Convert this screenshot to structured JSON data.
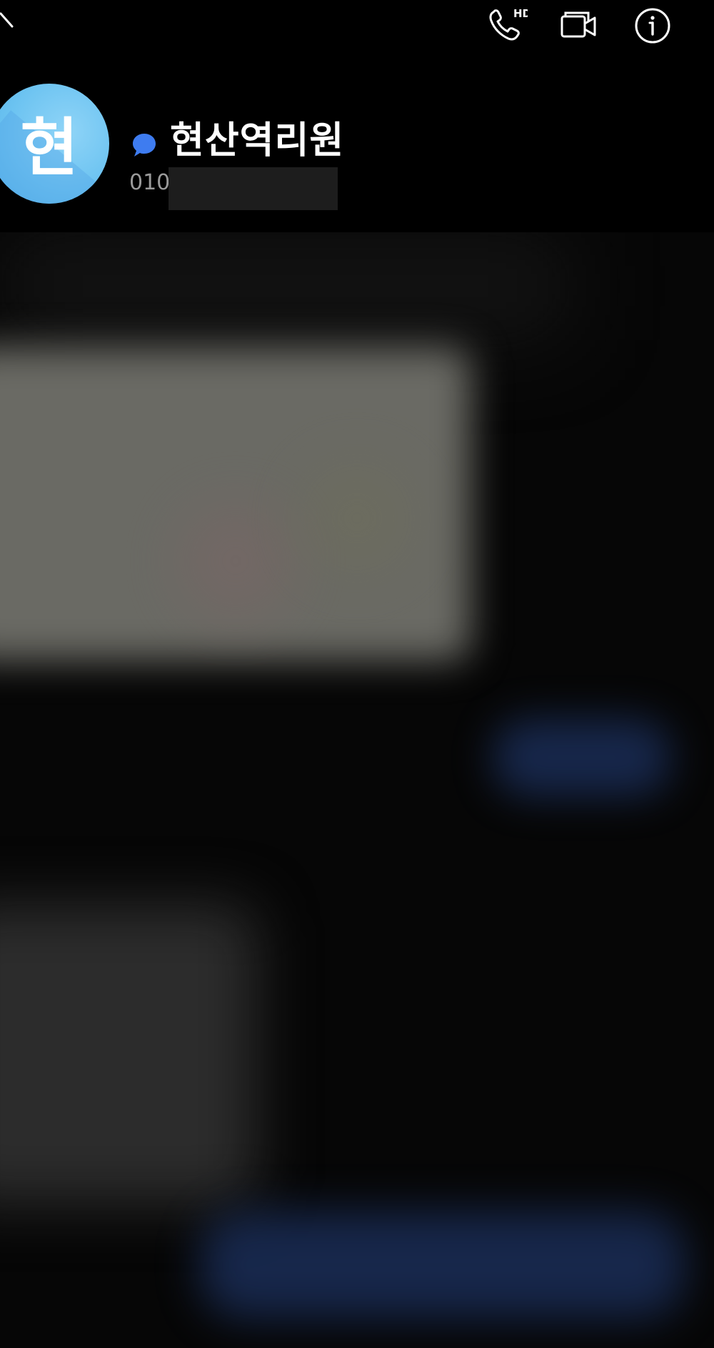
{
  "header": {
    "back_icon": "chevron-up-icon",
    "actions": [
      {
        "name": "hd-voice-call",
        "icon": "phone-hd-icon",
        "badge": "HD"
      },
      {
        "name": "video-call",
        "icon": "video-camera-icon"
      },
      {
        "name": "conversation-info",
        "icon": "info-circle-icon"
      }
    ]
  },
  "contact": {
    "avatar_letter": "현",
    "avatar_color": "#6cc3f1",
    "chat_badge_color": "#3e7cf0",
    "name": "현산역리원",
    "number_visible": "010"
  },
  "colors": {
    "background": "#000000",
    "sent_bubble": "#1a2d57",
    "received_bubble": "#2c2c2c"
  }
}
